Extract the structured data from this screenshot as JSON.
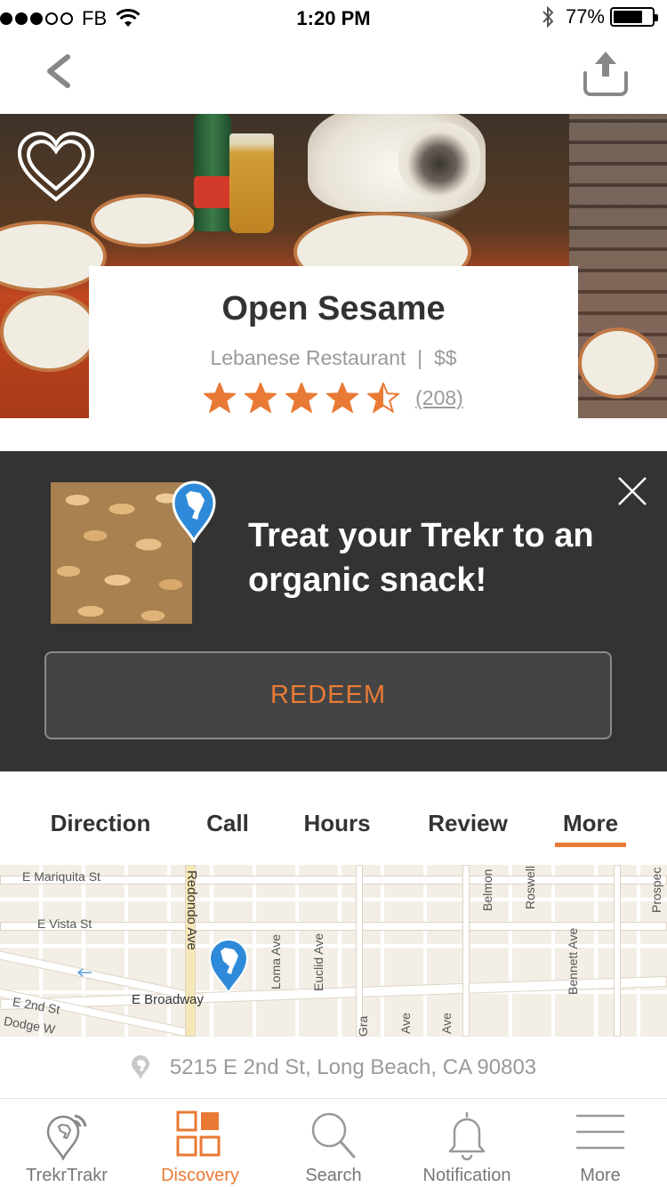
{
  "status_bar": {
    "carrier": "FB",
    "time": "1:20 PM",
    "battery": "77%",
    "battery_level": 0.77,
    "signal_bars": 3,
    "signal_total": 5
  },
  "restaurant": {
    "name": "Open Sesame",
    "category": "Lebanese Restaurant",
    "separator": "|",
    "price": "$$",
    "rating": 4.5,
    "rating_max": 5,
    "review_count": "(208)"
  },
  "promo": {
    "title": "Treat your Trekr to an organic snack!",
    "redeem_label": "REDEEM"
  },
  "tabs": [
    {
      "label": "Direction"
    },
    {
      "label": "Call"
    },
    {
      "label": "Hours"
    },
    {
      "label": "Review"
    },
    {
      "label": "More",
      "active": true
    }
  ],
  "map": {
    "labels": [
      "E Mariquita St",
      "E Vista St",
      "E 2nd St",
      "Dodge W",
      "E Broadway",
      "Redondo Ave",
      "Loma Ave",
      "Euclid Ave",
      "Gra",
      "Ave",
      "Ave",
      "Belmon",
      "Roswell",
      "Bennett Ave",
      "Prospec"
    ]
  },
  "address": "5215 E 2nd St, Long Beach, CA 90803",
  "bottom_nav": [
    {
      "label": "TrekrTrakr",
      "icon": "location-signal-icon"
    },
    {
      "label": "Discovery",
      "icon": "grid-icon",
      "active": true
    },
    {
      "label": "Search",
      "icon": "search-icon"
    },
    {
      "label": "Notification",
      "icon": "bell-icon"
    },
    {
      "label": "More",
      "icon": "menu-icon"
    }
  ],
  "colors": {
    "accent": "#e97a35",
    "promo_bg": "#333333",
    "pin_blue": "#2e8ad8"
  }
}
